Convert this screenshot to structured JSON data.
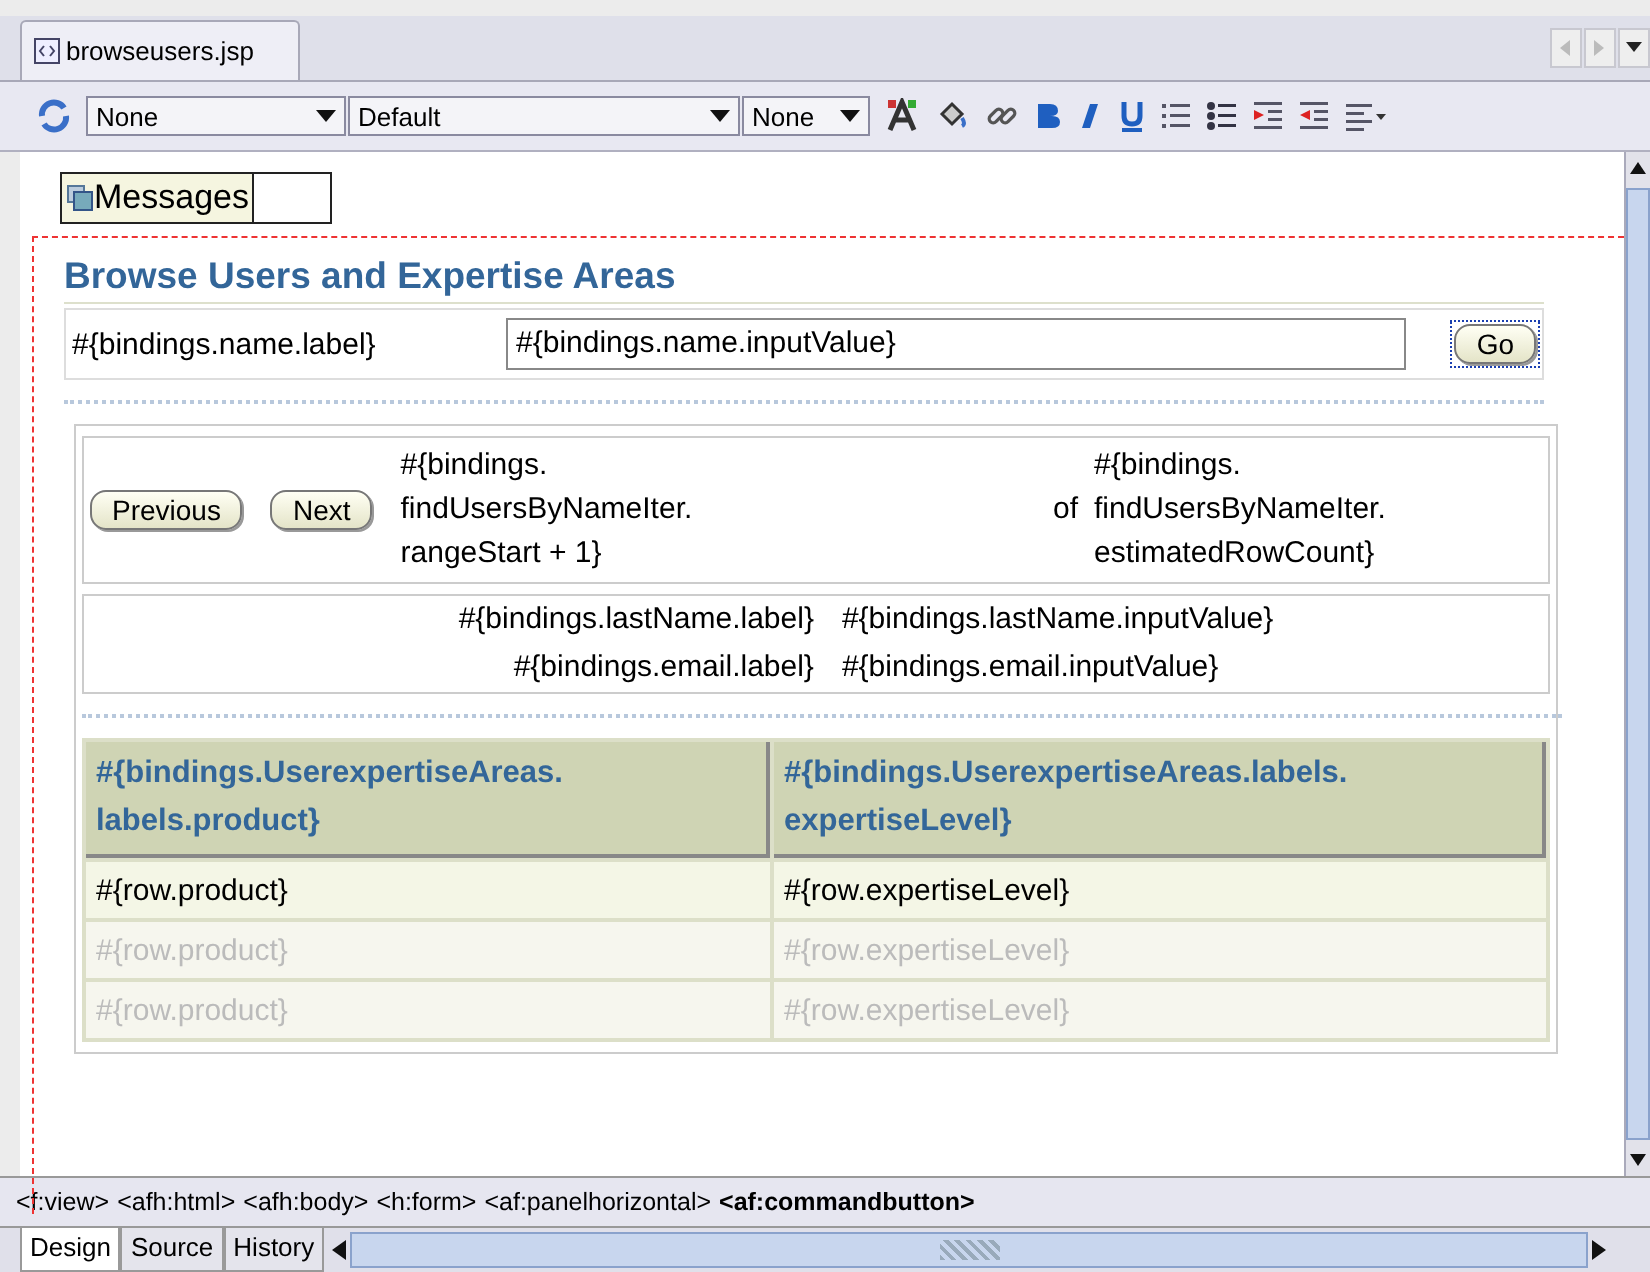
{
  "editor_tab": {
    "title": "browseusers.jsp",
    "selected": true
  },
  "toolbar": {
    "dropdowns": [
      {
        "value": "None"
      },
      {
        "value": "Default"
      },
      {
        "value": "None"
      }
    ]
  },
  "messages": {
    "label": "Messages"
  },
  "page": {
    "title": "Browse Users and Expertise Areas",
    "search": {
      "label": "#{bindings.name.label}",
      "value": "#{bindings.name.inputValue}",
      "button": "Go"
    },
    "navigation": {
      "previous": "Previous",
      "next": "Next",
      "range_start": [
        "#{bindings.",
        "findUsersByNameIter.",
        "rangeStart + 1}"
      ],
      "of": "of",
      "row_count": [
        "#{bindings.",
        "findUsersByNameIter.",
        "estimatedRowCount}"
      ]
    },
    "details": [
      {
        "label": "#{bindings.lastName.label}",
        "value": "#{bindings.lastName.inputValue}"
      },
      {
        "label": "#{bindings.email.label}",
        "value": "#{bindings.email.inputValue}"
      }
    ],
    "table": {
      "columns": [
        "#{bindings.UserexpertiseAreas. labels.product}",
        "#{bindings.UserexpertiseAreas.labels. expertiseLevel}"
      ],
      "rows": [
        {
          "kind": "template",
          "cells": [
            "#{row.product}",
            "#{row.expertiseLevel}"
          ]
        },
        {
          "kind": "preview",
          "cells": [
            "#{row.product}",
            "#{row.expertiseLevel}"
          ]
        },
        {
          "kind": "preview",
          "cells": [
            "#{row.product}",
            "#{row.expertiseLevel}"
          ]
        }
      ]
    }
  },
  "status_bar": {
    "breadcrumb": [
      {
        "tag": "<f:view>",
        "selected": false
      },
      {
        "tag": "<afh:html>",
        "selected": false
      },
      {
        "tag": "<afh:body>",
        "selected": false
      },
      {
        "tag": "<h:form>",
        "selected": false
      },
      {
        "tag": "<af:panelhorizontal>",
        "selected": false
      },
      {
        "tag": "<af:commandbutton>",
        "selected": true
      }
    ]
  },
  "view_tabs": [
    {
      "label": "Design",
      "selected": true
    },
    {
      "label": "Source",
      "selected": false
    },
    {
      "label": "History",
      "selected": false
    }
  ]
}
